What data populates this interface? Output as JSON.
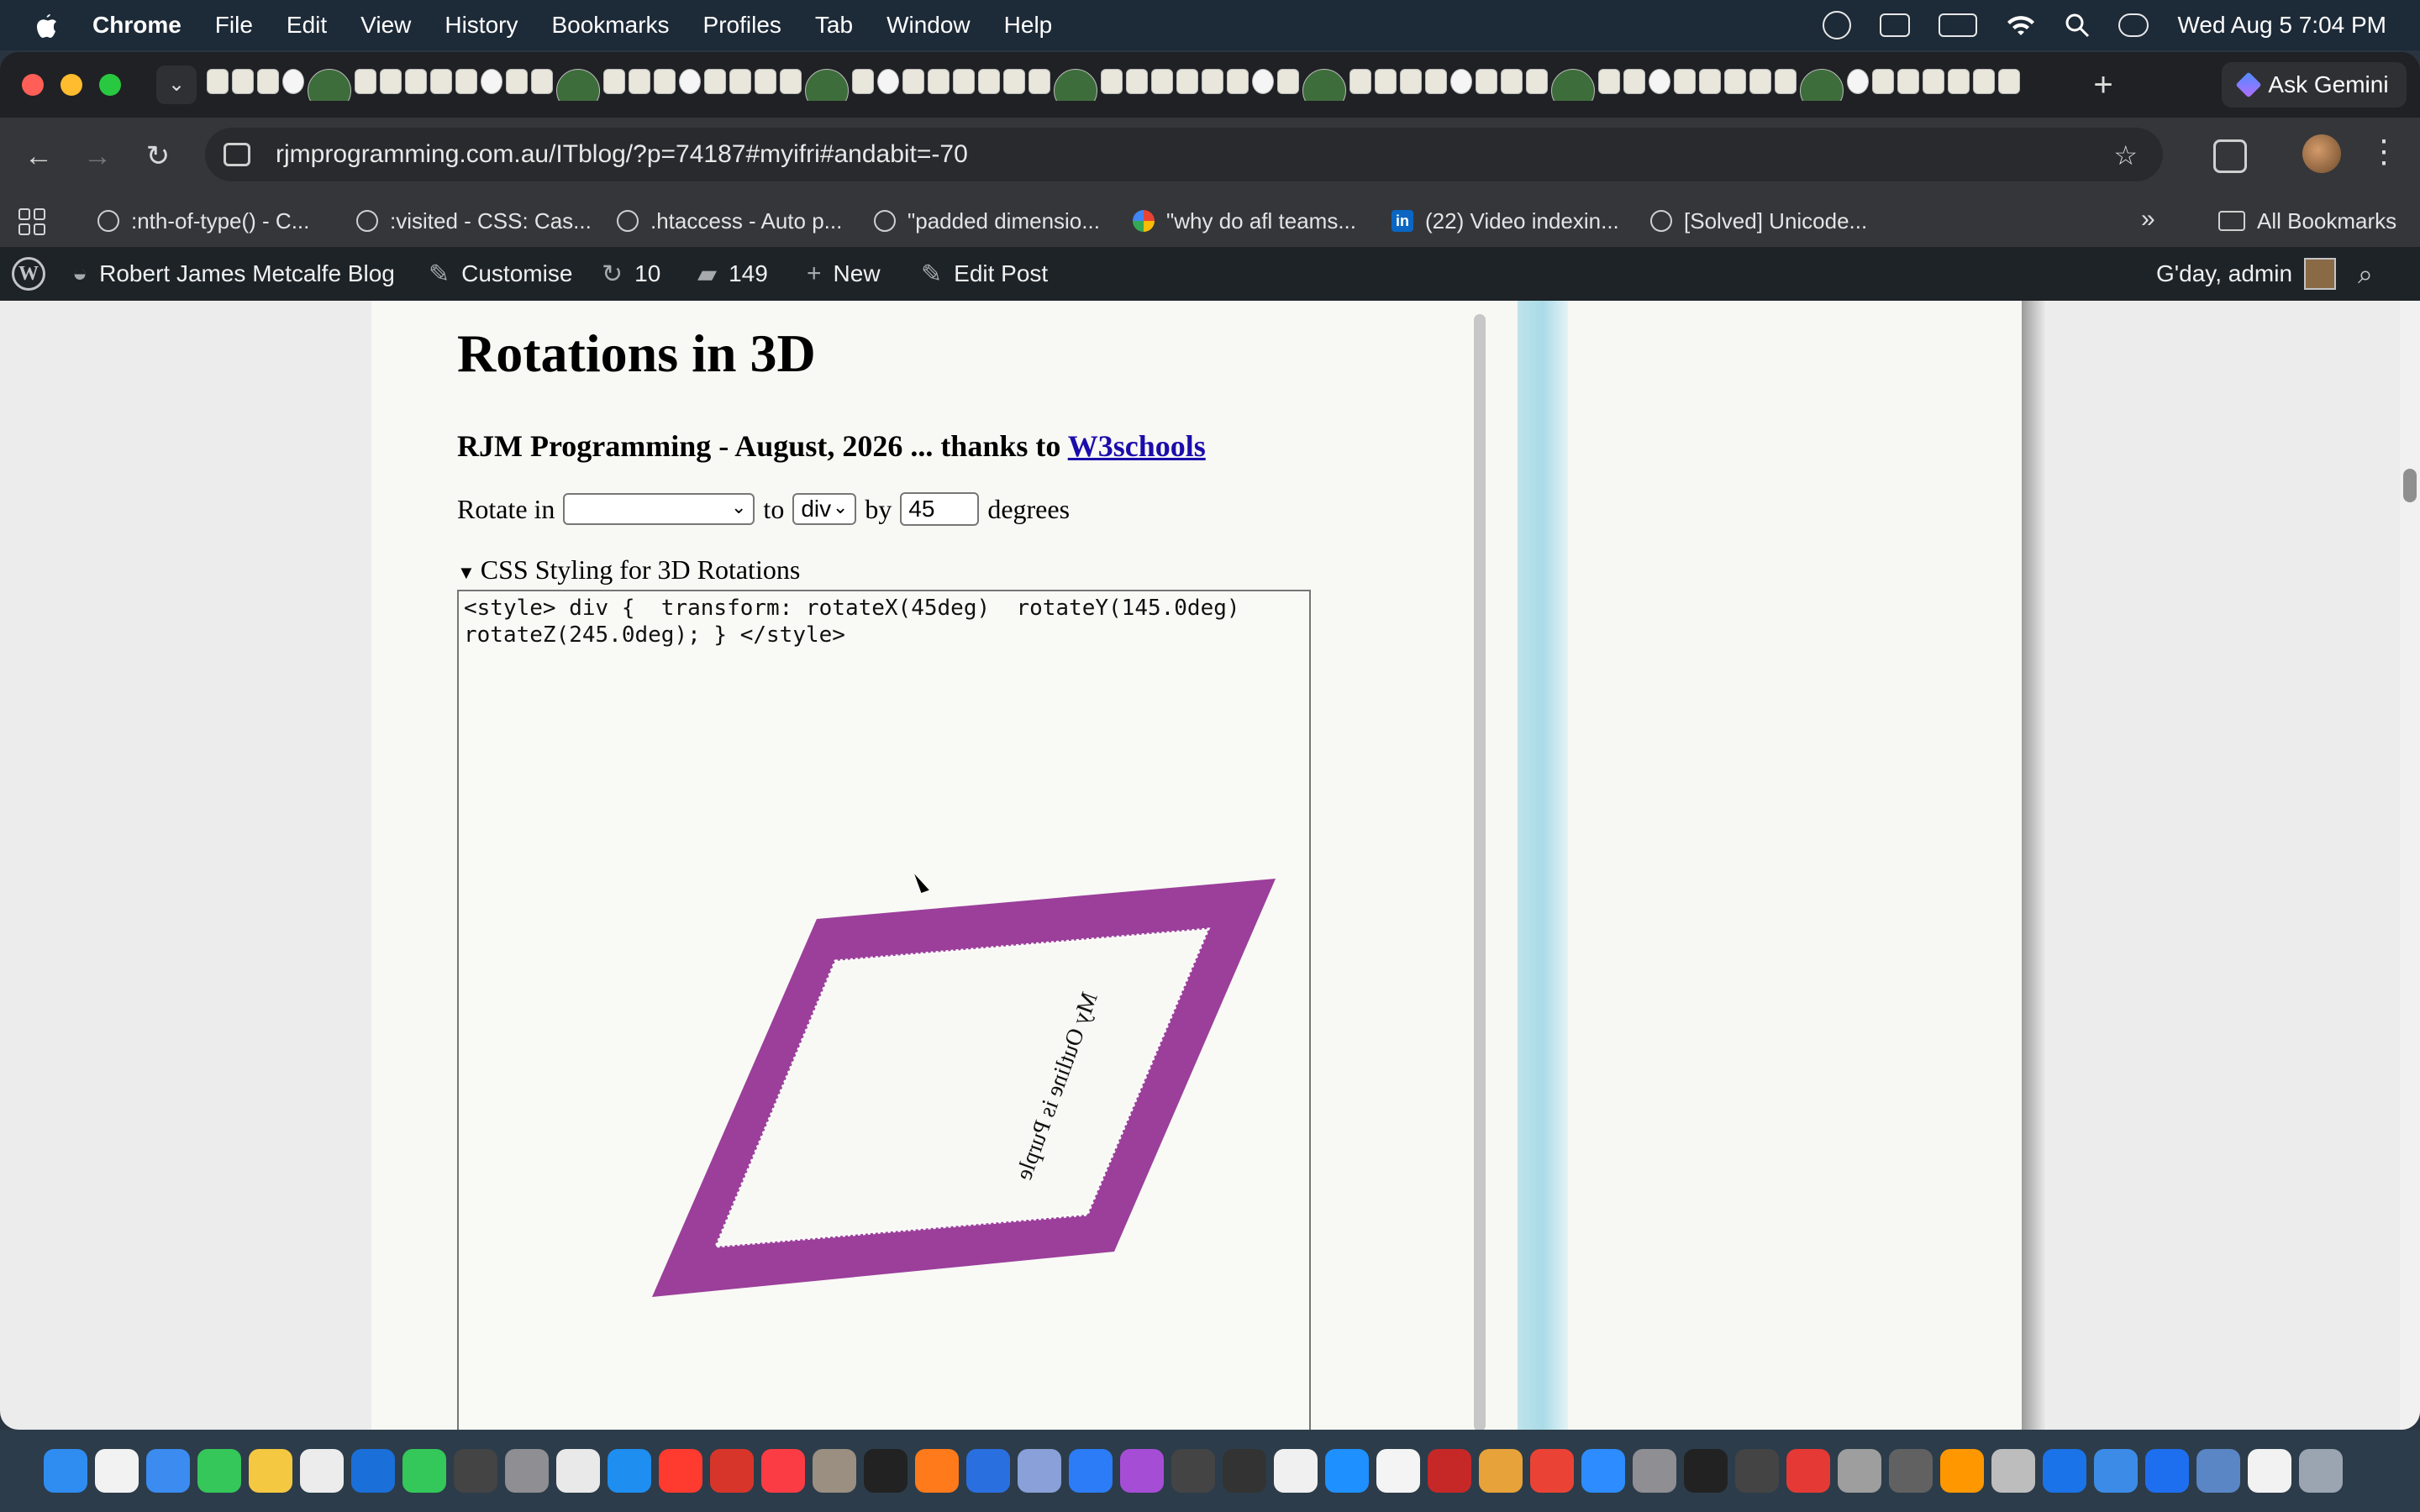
{
  "menubar": {
    "app": "Chrome",
    "items": [
      "File",
      "Edit",
      "View",
      "History",
      "Bookmarks",
      "Profiles",
      "Tab",
      "Window",
      "Help"
    ],
    "clock": "Wed Aug 5  7:04 PM"
  },
  "browser": {
    "ask_gemini": "Ask Gemini",
    "url": "rjmprogramming.com.au/ITblog/?p=74187#myifri#andabit=-70",
    "bookmarks": [
      ":nth-of-type() - C...",
      ":visited - CSS: Cas...",
      ".htaccess - Auto p...",
      "\"padded dimensio...",
      "\"why do afl teams...",
      "(22) Video indexin...",
      "[Solved] Unicode..."
    ],
    "all_bookmarks": "All Bookmarks"
  },
  "wpbar": {
    "site": "Robert James Metcalfe Blog",
    "customise": "Customise",
    "updates": "10",
    "comments": "149",
    "new": "New",
    "edit": "Edit Post",
    "greeting": "G'day, admin"
  },
  "page": {
    "title": "Rotations in 3D",
    "subtitle_prefix": "RJM Programming - August, 2026 ... thanks to ",
    "subtitle_link": "W3schools",
    "rotate_in_label": "Rotate in",
    "rotate_in_value": "",
    "to_label": "to",
    "to_value": "div",
    "by_label": "by",
    "degrees_value": "45",
    "degrees_label": "degrees",
    "details_summary": "CSS Styling for 3D Rotations",
    "css_code": "<style> div {  transform: rotateX(45deg)  rotateY(145.0deg) rotateZ(245.0deg); } </style>",
    "mirrored_text": "My Outline is Purple",
    "border_color": "#9b3f9b"
  }
}
